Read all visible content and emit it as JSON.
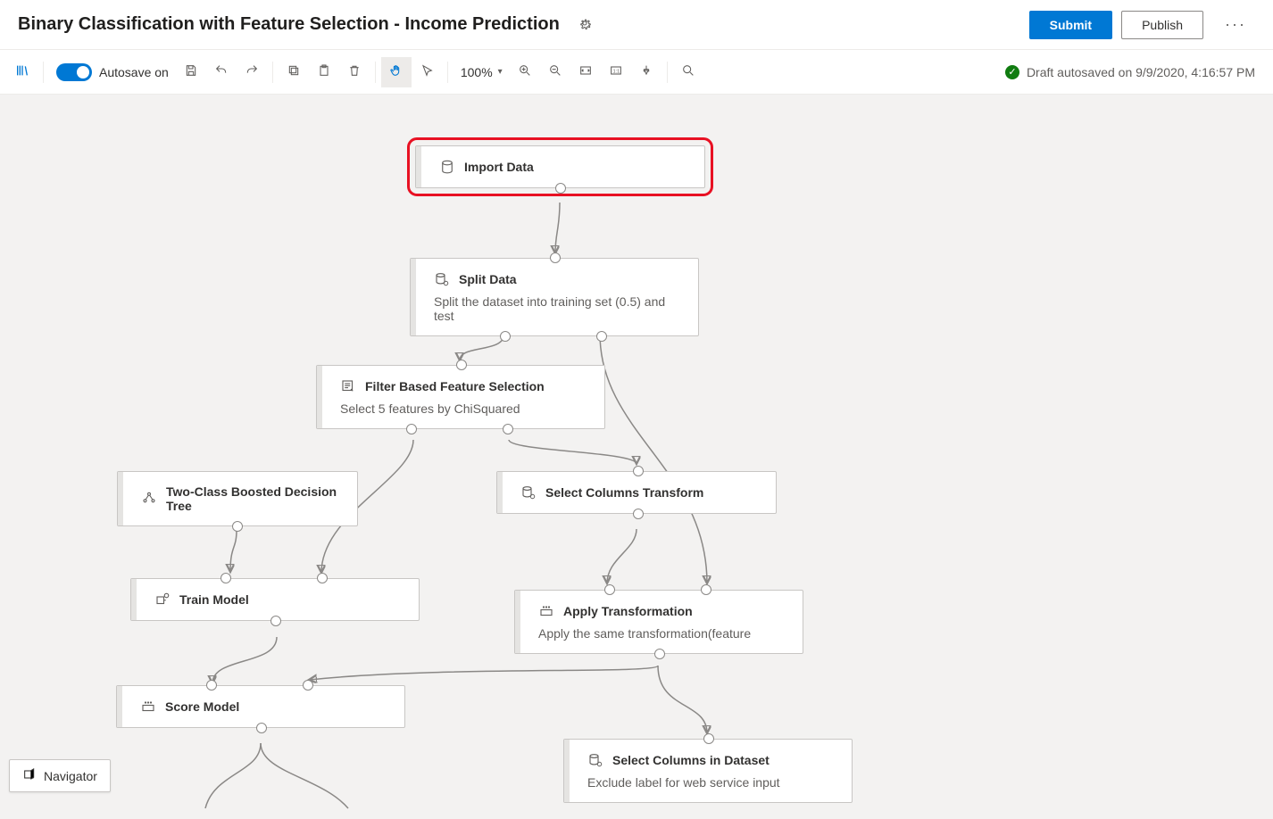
{
  "header": {
    "title": "Binary Classification with Feature Selection - Income Prediction",
    "submit_label": "Submit",
    "publish_label": "Publish"
  },
  "toolbar": {
    "autosave_label": "Autosave on",
    "zoom_label": "100%",
    "icons": {
      "library": "library-icon",
      "save": "save-icon",
      "undo": "undo-icon",
      "redo": "redo-icon",
      "copy": "copy-icon",
      "paste": "paste-icon",
      "delete": "delete-icon",
      "pan": "pan-icon",
      "pointer": "pointer-icon",
      "zoom_in": "zoom-in-icon",
      "zoom_out": "zoom-out-icon",
      "fit": "fit-screen-icon",
      "actual": "actual-size-icon",
      "autolayout": "auto-layout-icon",
      "search": "search-icon"
    }
  },
  "status": {
    "text": "Draft autosaved on 9/9/2020, 4:16:57 PM"
  },
  "navigator_label": "Navigator",
  "modules": {
    "import_data": {
      "title": "Import Data"
    },
    "split_data": {
      "title": "Split Data",
      "desc": "Split the dataset into training set (0.5) and test"
    },
    "filter_feature": {
      "title": "Filter Based Feature Selection",
      "desc": "Select 5 features by ChiSquared"
    },
    "boosted_tree": {
      "title": "Two-Class Boosted Decision Tree"
    },
    "select_cols_transform": {
      "title": "Select Columns Transform"
    },
    "train_model": {
      "title": "Train Model"
    },
    "apply_transform": {
      "title": "Apply Transformation",
      "desc": "Apply the same transformation(feature"
    },
    "score_model": {
      "title": "Score Model"
    },
    "select_cols_dataset": {
      "title": "Select Columns in Dataset",
      "desc": "Exclude label for web service input"
    }
  }
}
